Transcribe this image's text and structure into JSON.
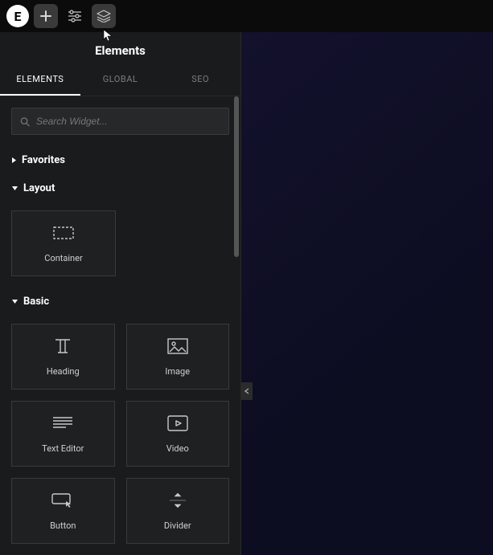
{
  "topbar": {
    "logo_letter": "E"
  },
  "panel": {
    "title": "Elements",
    "tabs": [
      "ELEMENTS",
      "GLOBAL",
      "SEO"
    ],
    "active_tab": 0,
    "search_placeholder": "Search Widget...",
    "sections": {
      "favorites": {
        "label": "Favorites",
        "expanded": false
      },
      "layout": {
        "label": "Layout",
        "expanded": true,
        "widgets": [
          {
            "id": "container",
            "label": "Container"
          }
        ]
      },
      "basic": {
        "label": "Basic",
        "expanded": true,
        "widgets": [
          {
            "id": "heading",
            "label": "Heading"
          },
          {
            "id": "image",
            "label": "Image"
          },
          {
            "id": "text-editor",
            "label": "Text Editor"
          },
          {
            "id": "video",
            "label": "Video"
          },
          {
            "id": "button",
            "label": "Button"
          },
          {
            "id": "divider",
            "label": "Divider"
          }
        ]
      }
    }
  }
}
